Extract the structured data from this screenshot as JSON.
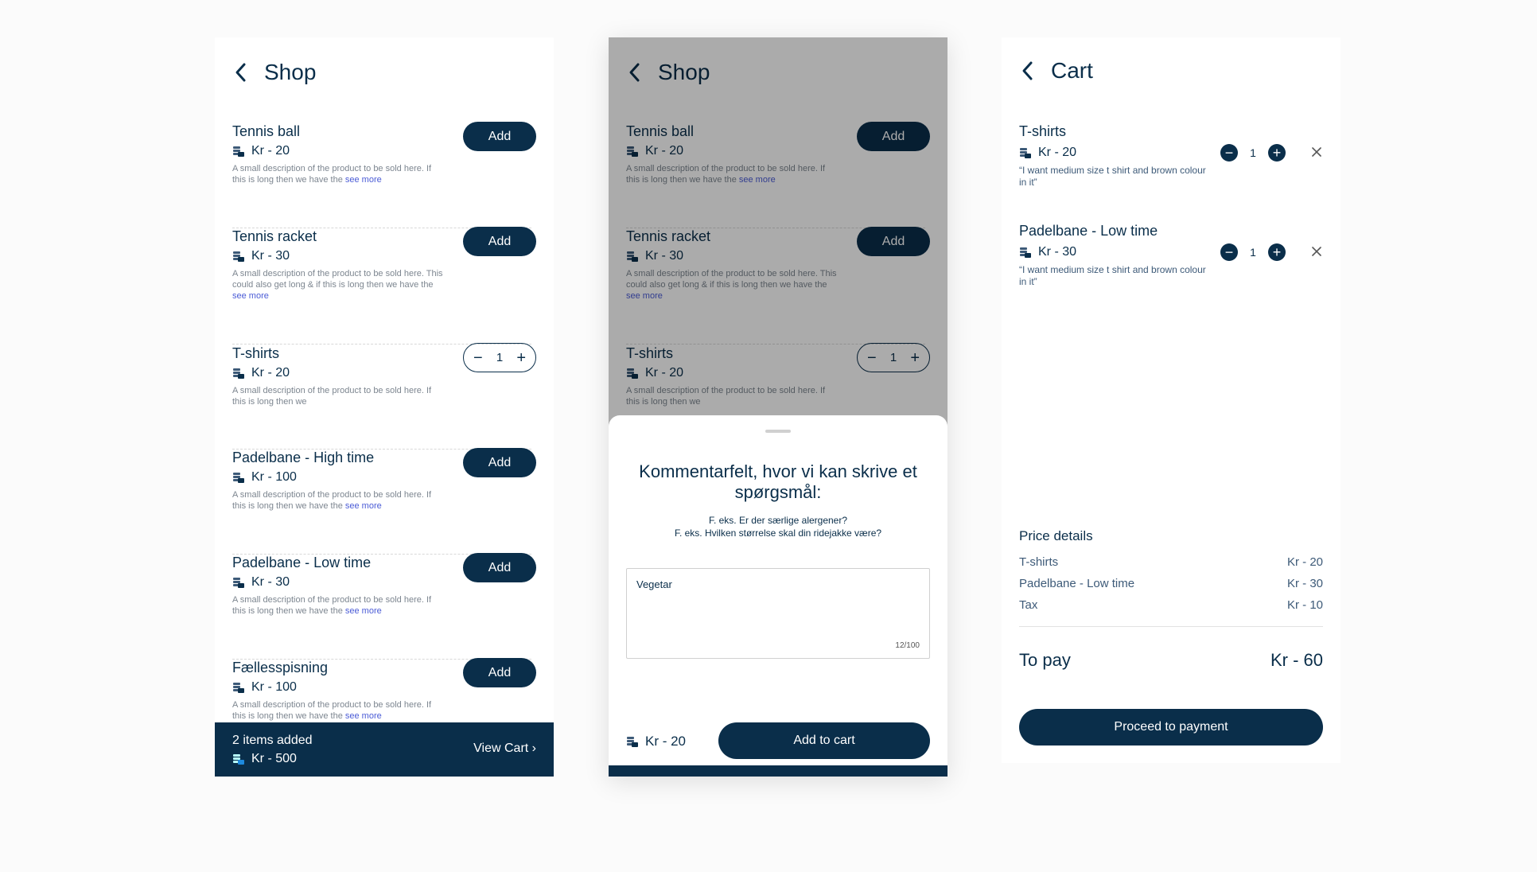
{
  "shop": {
    "title": "Shop",
    "products": [
      {
        "name": "Tennis ball",
        "price": "Kr - 20",
        "desc": "A small description of the product to be sold here. If this is long then we have the",
        "more": "see more",
        "action": "Add"
      },
      {
        "name": "Tennis racket",
        "price": "Kr - 30",
        "desc": "A small description of the product to be sold here. This could also get long & if this is long then we have the",
        "more": "see more",
        "action": "Add"
      },
      {
        "name": "T-shirts",
        "price": "Kr - 20",
        "desc": "A small description of the product to be sold here. If this is long then we",
        "more": "",
        "qty": "1"
      },
      {
        "name": "Padelbane - High time",
        "price": "Kr - 100",
        "desc": "A small description of the product to be sold here. If this is long then we have the",
        "more": "see more",
        "action": "Add"
      },
      {
        "name": "Padelbane - Low time",
        "price": "Kr - 30",
        "desc": "A small description of the product to be sold here. If this is long then we have the",
        "more": "see more",
        "action": "Add"
      },
      {
        "name": "Fællesspisning",
        "price": "Kr - 100",
        "desc": "A small description of the product to be sold here. If this is long then we have the",
        "more": "see more",
        "action": "Add"
      }
    ],
    "cart_bar": {
      "items": "2 items added",
      "total": "Kr - 500",
      "view": "View Cart ›"
    }
  },
  "sheet": {
    "question": "Kommentarfelt, hvor vi kan skrive et spørgsmål:",
    "hint1": "F. eks. Er der særlige alergener?",
    "hint2": "F. eks. Hvilken størrelse skal din ridejakke være?",
    "value": "Vegetar",
    "counter": "12/100",
    "price": "Kr - 20",
    "add_to_cart": "Add to cart"
  },
  "cart": {
    "title": "Cart",
    "items": [
      {
        "name": "T-shirts",
        "price": "Kr - 20",
        "qty": "1",
        "note": "“I want medium size t shirt and brown colour in it”"
      },
      {
        "name": "Padelbane - Low time",
        "price": "Kr - 30",
        "qty": "1",
        "note": "“I want medium size t shirt and brown colour in it”"
      }
    ],
    "price_details": {
      "title": "Price details",
      "rows": [
        {
          "label": "T-shirts",
          "value": "Kr - 20"
        },
        {
          "label": "Padelbane - Low time",
          "value": "Kr - 30"
        },
        {
          "label": "Tax",
          "value": "Kr - 10"
        }
      ]
    },
    "to_pay_label": "To pay",
    "to_pay_value": "Kr - 60",
    "proceed": "Proceed to payment"
  },
  "icons": [
    "back-icon",
    "coin-icon",
    "minus-icon",
    "plus-icon",
    "close-icon"
  ],
  "colors": {
    "primary": "#0a2e4a",
    "link": "#4a5bd6"
  }
}
